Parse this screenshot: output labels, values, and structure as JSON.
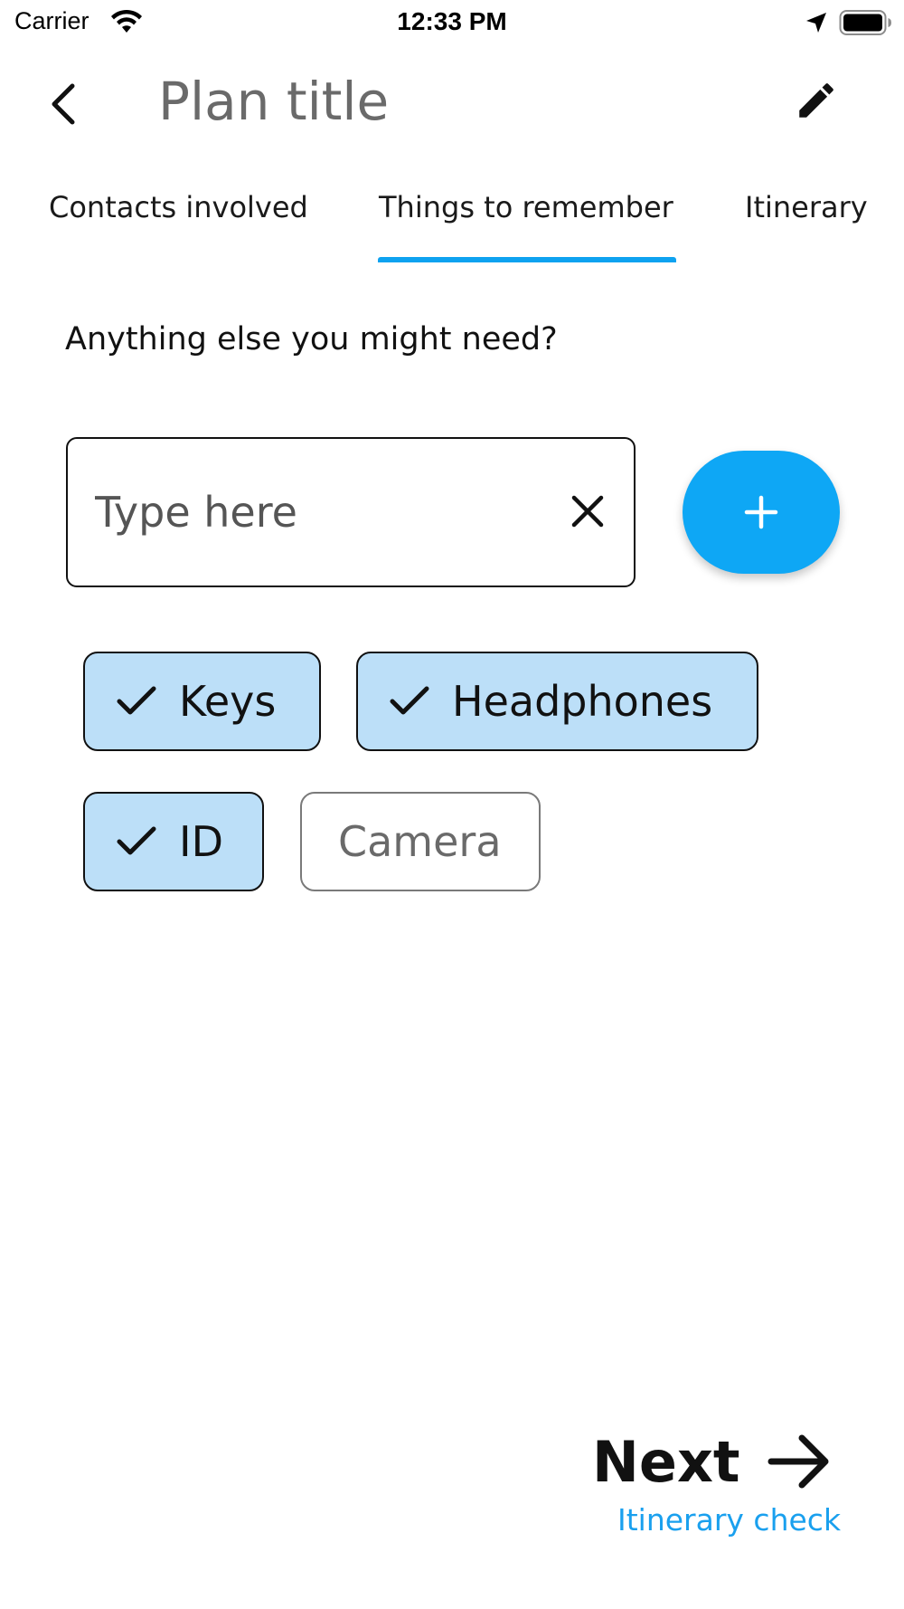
{
  "status_bar": {
    "carrier": "Carrier",
    "time": "12:33 PM"
  },
  "header": {
    "title": "Plan title"
  },
  "tabs": [
    {
      "label": "Contacts involved",
      "selected": false
    },
    {
      "label": "Things to remember",
      "selected": true
    },
    {
      "label": "Itinerary",
      "selected": false
    }
  ],
  "main": {
    "prompt": "Anything else you might need?",
    "input": {
      "placeholder": "Type here",
      "value": ""
    },
    "chips": [
      {
        "label": "Keys",
        "selected": true
      },
      {
        "label": "Headphones",
        "selected": true
      },
      {
        "label": "ID",
        "selected": true
      },
      {
        "label": "Camera",
        "selected": false
      }
    ]
  },
  "footer": {
    "next_label": "Next",
    "next_sublabel": "Itinerary check"
  },
  "colors": {
    "accent": "#0ea7f5",
    "chip_selected_bg": "#bcdff8",
    "title_gray": "#6a6a6a"
  },
  "icons": {
    "back": "chevron-left-icon",
    "edit": "pencil-icon",
    "clear": "close-icon",
    "add": "plus-icon",
    "check": "check-icon",
    "next": "arrow-right-icon"
  }
}
